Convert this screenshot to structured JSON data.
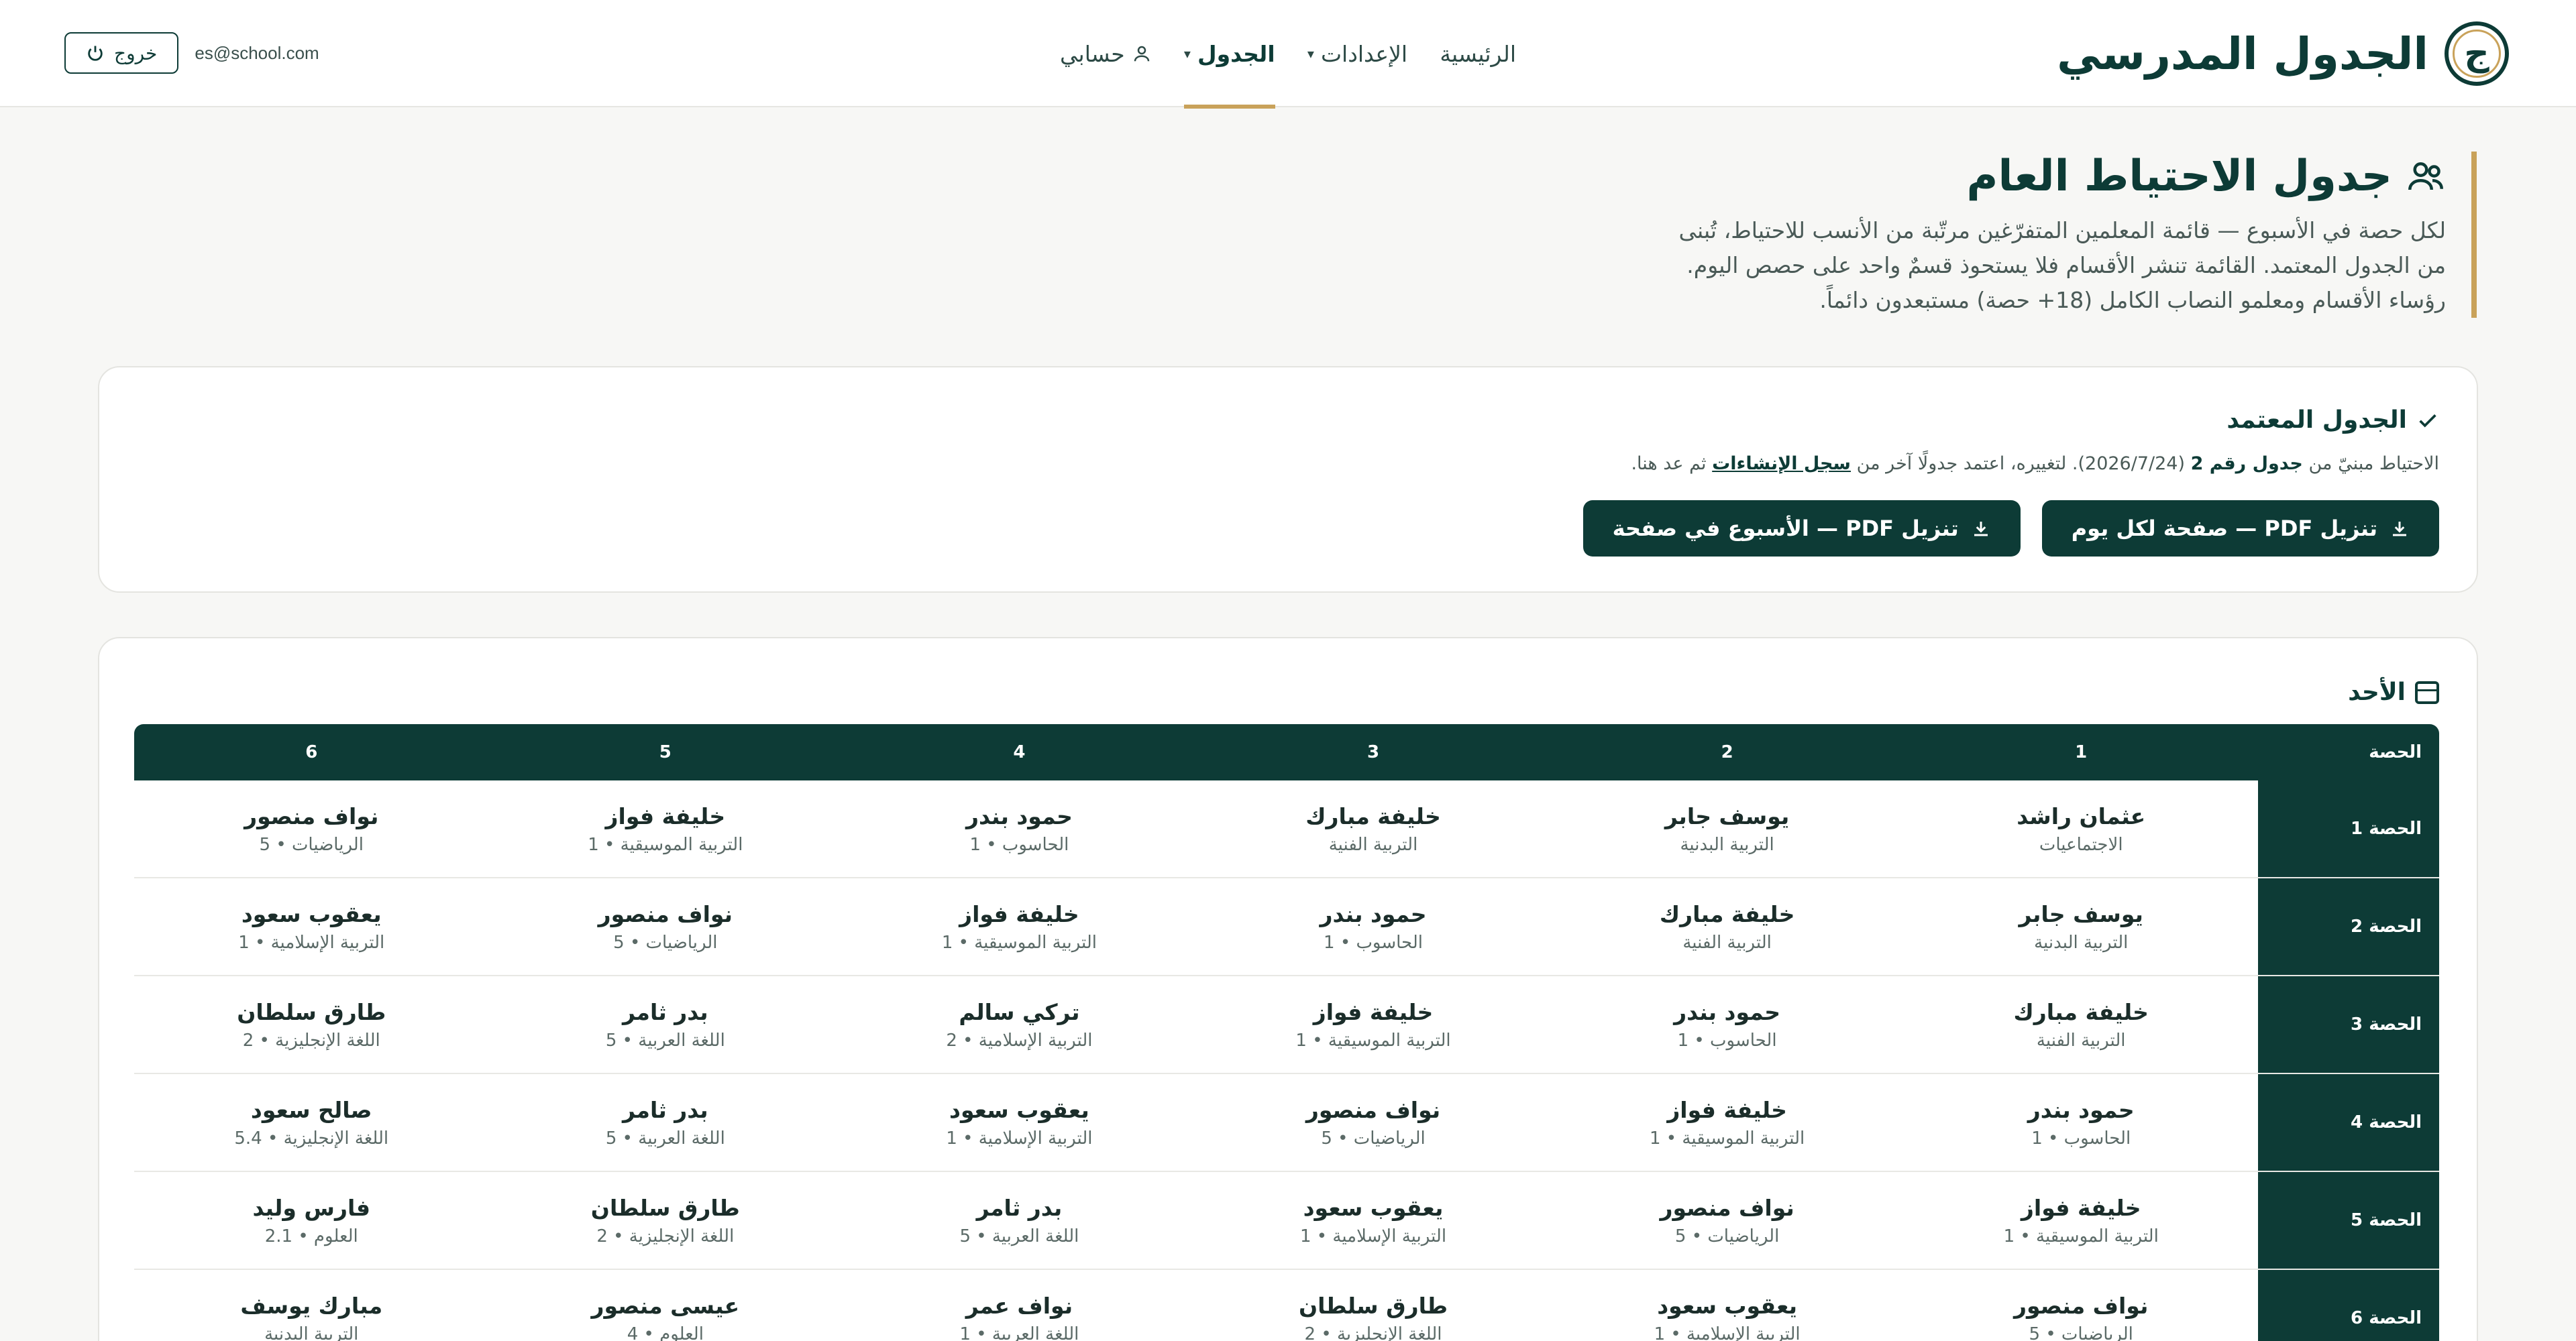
{
  "brand": {
    "logo_glyph": "ج",
    "title": "الجدول المدرسي"
  },
  "nav": {
    "items": [
      {
        "label": "الرئيسية"
      },
      {
        "label": "الإعدادات",
        "caret": "▾"
      },
      {
        "label": "الجدول",
        "caret": "▾"
      },
      {
        "label": "حسابي"
      }
    ]
  },
  "session": {
    "logout_label": "خروج",
    "email": "es@school.com"
  },
  "intro": {
    "title": "جدول الاحتياط العام",
    "lines": [
      "لكل حصة في الأسبوع — قائمة المعلمين المتفرّغين مرتّبة من الأنسب للاحتياط، تُبنى",
      "من الجدول المعتمد. القائمة تنشر الأقسام فلا يستحوذ قسمٌ واحد على حصص اليوم.",
      "رؤساء الأقسام ومعلمو النصاب الكامل (18+ حصة) مستبعدون دائماً."
    ]
  },
  "approved": {
    "title": "الجدول المعتمد",
    "note_prefix": "الاحتياط مبنيّ من",
    "note_bold": "جدول رقم 2",
    "note_date": "(2026/7/24). لتغييره، اعتمد جدولًا آخر من",
    "note_link": "سجل الإنشاءات",
    "note_suffix": "ثم عد هنا.",
    "btn_daily": "تنزيل PDF — صفحة لكل يوم",
    "btn_weekly": "تنزيل PDF — الأسبوع في صفحة"
  },
  "day": {
    "title": "الأحد",
    "header_first": "الحصة",
    "columns": [
      "1",
      "2",
      "3",
      "4",
      "5",
      "6"
    ],
    "rows": [
      {
        "label": "الحصة 1",
        "cells": [
          {
            "t": "عثمان راشد",
            "s": "الاجتماعيات"
          },
          {
            "t": "يوسف جابر",
            "s": "التربية البدنية"
          },
          {
            "t": "خليفة مبارك",
            "s": "التربية الفنية"
          },
          {
            "t": "حمود بندر",
            "s": "الحاسوب • 1"
          },
          {
            "t": "خليفة فواز",
            "s": "التربية الموسيقية • 1"
          },
          {
            "t": "نواف منصور",
            "s": "الرياضيات • 5"
          }
        ]
      },
      {
        "label": "الحصة 2",
        "cells": [
          {
            "t": "يوسف جابر",
            "s": "التربية البدنية"
          },
          {
            "t": "خليفة مبارك",
            "s": "التربية الفنية"
          },
          {
            "t": "حمود بندر",
            "s": "الحاسوب • 1"
          },
          {
            "t": "خليفة فواز",
            "s": "التربية الموسيقية • 1"
          },
          {
            "t": "نواف منصور",
            "s": "الرياضيات • 5"
          },
          {
            "t": "يعقوب سعود",
            "s": "التربية الإسلامية • 1"
          }
        ]
      },
      {
        "label": "الحصة 3",
        "cells": [
          {
            "t": "خليفة مبارك",
            "s": "التربية الفنية"
          },
          {
            "t": "حمود بندر",
            "s": "الحاسوب • 1"
          },
          {
            "t": "خليفة فواز",
            "s": "التربية الموسيقية • 1"
          },
          {
            "t": "تركي سالم",
            "s": "التربية الإسلامية • 2"
          },
          {
            "t": "بدر ثامر",
            "s": "اللغة العربية • 5"
          },
          {
            "t": "طارق سلطان",
            "s": "اللغة الإنجليزية • 2"
          }
        ]
      },
      {
        "label": "الحصة 4",
        "cells": [
          {
            "t": "حمود بندر",
            "s": "الحاسوب • 1"
          },
          {
            "t": "خليفة فواز",
            "s": "التربية الموسيقية • 1"
          },
          {
            "t": "نواف منصور",
            "s": "الرياضيات • 5"
          },
          {
            "t": "يعقوب سعود",
            "s": "التربية الإسلامية • 1"
          },
          {
            "t": "بدر ثامر",
            "s": "اللغة العربية • 5"
          },
          {
            "t": "صالح سعود",
            "s": "اللغة الإنجليزية • 5.4"
          }
        ]
      },
      {
        "label": "الحصة 5",
        "cells": [
          {
            "t": "خليفة فواز",
            "s": "التربية الموسيقية • 1"
          },
          {
            "t": "نواف منصور",
            "s": "الرياضيات • 5"
          },
          {
            "t": "يعقوب سعود",
            "s": "التربية الإسلامية • 1"
          },
          {
            "t": "بدر ثامر",
            "s": "اللغة العربية • 5"
          },
          {
            "t": "طارق سلطان",
            "s": "اللغة الإنجليزية • 2"
          },
          {
            "t": "فارس وليد",
            "s": "العلوم • 2.1"
          }
        ]
      },
      {
        "label": "الحصة 6",
        "cells": [
          {
            "t": "نواف منصور",
            "s": "الرياضيات • 5"
          },
          {
            "t": "يعقوب سعود",
            "s": "التربية الإسلامية • 1"
          },
          {
            "t": "طارق سلطان",
            "s": "اللغة الإنجليزية • 2"
          },
          {
            "t": "نواف عمر",
            "s": "اللغة العربية • 1"
          },
          {
            "t": "عيسى منصور",
            "s": "العلوم • 4"
          },
          {
            "t": "مبارك يوسف",
            "s": "التربية البدنية"
          }
        ]
      }
    ]
  },
  "colors": {
    "primary": "#0d3b36",
    "accent": "#c9a25a",
    "background": "#f7f7f5"
  },
  "icons": {
    "logout": "power-icon",
    "user": "user-icon",
    "group": "users-icon",
    "check": "check-icon",
    "download": "download-icon",
    "calendar": "calendar-icon"
  }
}
